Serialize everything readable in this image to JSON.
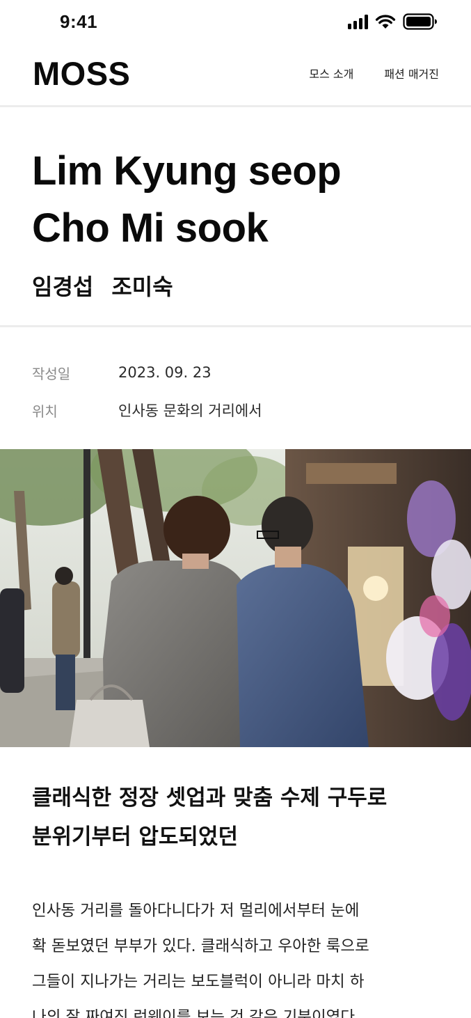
{
  "status_bar": {
    "time": "9:41",
    "icons": [
      "cellular-signal-icon",
      "wifi-icon",
      "battery-icon"
    ]
  },
  "header": {
    "logo": "MOSS",
    "nav": [
      {
        "label": "모스 소개"
      },
      {
        "label": "패션 매거진"
      }
    ]
  },
  "article": {
    "title_en_line1": "Lim Kyung seop",
    "title_en_line2": "Cho Mi sook",
    "names_kr": [
      "임경섭",
      "조미숙"
    ],
    "meta": [
      {
        "label": "작성일",
        "value": "2023. 09. 23"
      },
      {
        "label": "위치",
        "value": "인사동 문화의 거리에서"
      }
    ],
    "headline_line1": "클래식한 정장 셋업과 맞춤 수제 구두로",
    "headline_line2": "분위기부터 압도되었던",
    "body_lines": [
      "인사동 거리를 돌아다니다가 저 멀리에서부터 눈에",
      "확 돋보였던 부부가 있다. 클래식하고 우아한 룩으로",
      "그들이 지나가는 거리는 보도블럭이 아니라 마치 하",
      "나의 잘 짜여진 런웨이를 보는 것 같은 기분이였다."
    ]
  },
  "colors": {
    "text_primary": "#111111",
    "text_muted": "#8a8a8a",
    "divider": "#ececec",
    "background": "#ffffff"
  }
}
